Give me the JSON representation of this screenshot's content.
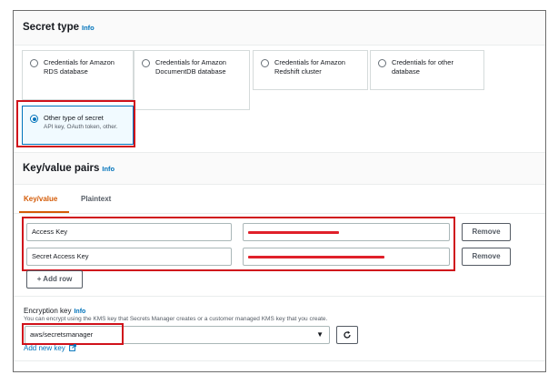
{
  "secret_type": {
    "title": "Secret type",
    "info": "Info",
    "options": [
      {
        "label": "Credentials for Amazon RDS database",
        "selected": false
      },
      {
        "label": "Credentials for Amazon DocumentDB database",
        "selected": false
      },
      {
        "label": "Credentials for Amazon Redshift cluster",
        "selected": false
      },
      {
        "label": "Credentials for other database",
        "selected": false
      },
      {
        "label": "Other type of secret",
        "description": "API key, OAuth token, other.",
        "selected": true
      }
    ]
  },
  "kv_pairs": {
    "title": "Key/value pairs",
    "info": "Info",
    "tabs": [
      {
        "label": "Key/value",
        "active": true
      },
      {
        "label": "Plaintext",
        "active": false
      }
    ],
    "rows": [
      {
        "key": "Access Key",
        "value": "",
        "remove_label": "Remove"
      },
      {
        "key": "Secret Access Key",
        "value": "",
        "remove_label": "Remove"
      }
    ],
    "add_row_label": "+ Add row"
  },
  "encryption": {
    "label": "Encryption key",
    "info": "Info",
    "description": "You can encrypt using the KMS key that Secrets Manager creates or a customer managed KMS key that you create.",
    "selected_key": "aws/secretsmanager",
    "add_new_key_label": "Add new key"
  },
  "colors": {
    "accent": "#0073bb",
    "tab_active": "#d45b07",
    "annotation_red": "#d0121b",
    "redaction": "#e0202a"
  },
  "icons": [
    "refresh-icon",
    "dropdown-caret-icon",
    "external-link-icon"
  ]
}
